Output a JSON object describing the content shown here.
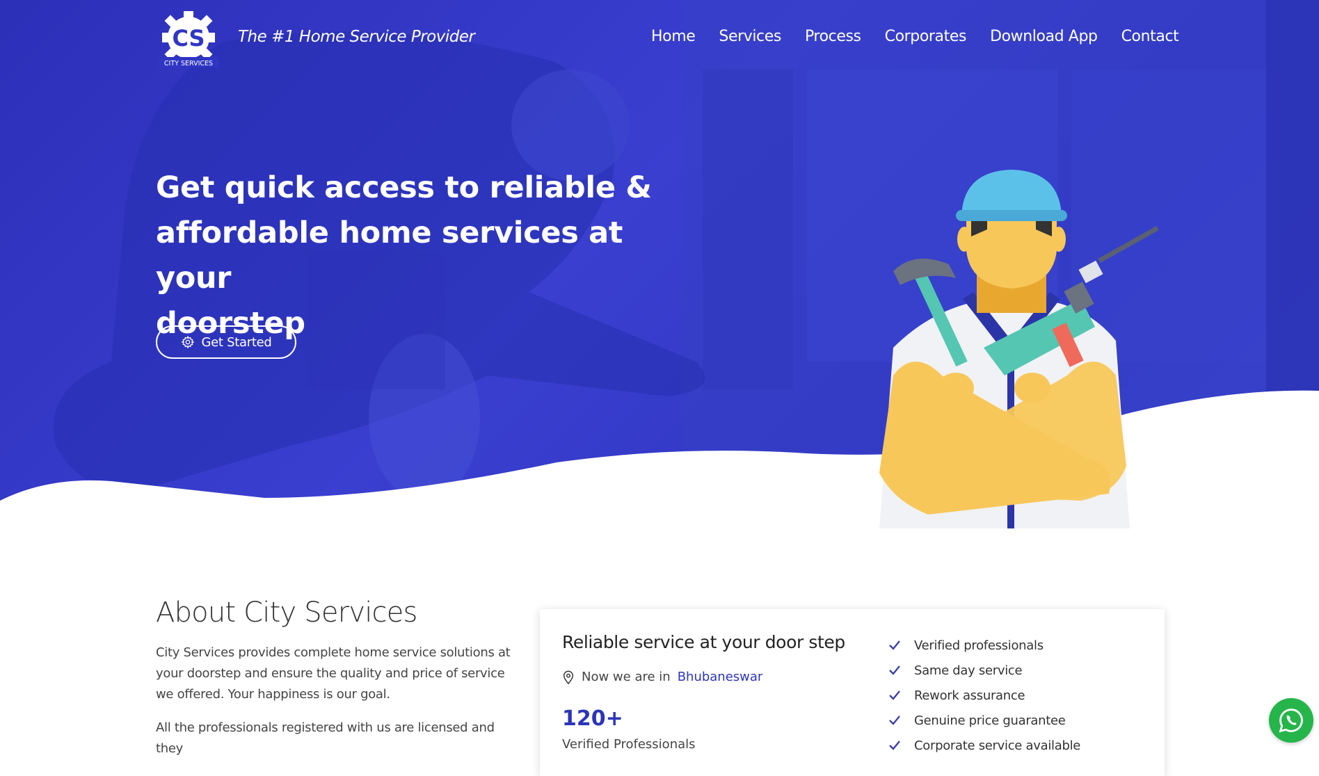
{
  "header": {
    "logo_text": "CS",
    "logo_subtext": "CITY SERVICES",
    "tagline": "The #1 Home Service Provider",
    "nav": [
      "Home",
      "Services",
      "Process",
      "Corporates",
      "Download App",
      "Contact"
    ]
  },
  "hero": {
    "headline_line1": "Get quick access to reliable &",
    "headline_line2": "affordable home services at your",
    "headline_line3": "doorstep",
    "cta_label": "Get Started",
    "cta_icon": "gear-icon"
  },
  "about": {
    "title": "About City Services",
    "paragraph1": "City Services provides complete home service solutions at your doorstep and ensure the quality and price of service we offered. Your happiness is our goal.",
    "paragraph2": "All the professionals registered with us are licensed and they"
  },
  "card": {
    "title": "Reliable service at your door step",
    "location_prefix": "Now we are in",
    "location_city": "Bhubaneswar",
    "stat_value": "120+",
    "stat_label": "Verified Professionals",
    "features": [
      "Verified professionals",
      "Same day service",
      "Rework assurance",
      "Genuine price guarantee",
      "Corporate service available"
    ]
  },
  "colors": {
    "brand_blue": "#2f36c4",
    "accent_blue": "#2b35b8",
    "whatsapp_green": "#25b54a"
  }
}
